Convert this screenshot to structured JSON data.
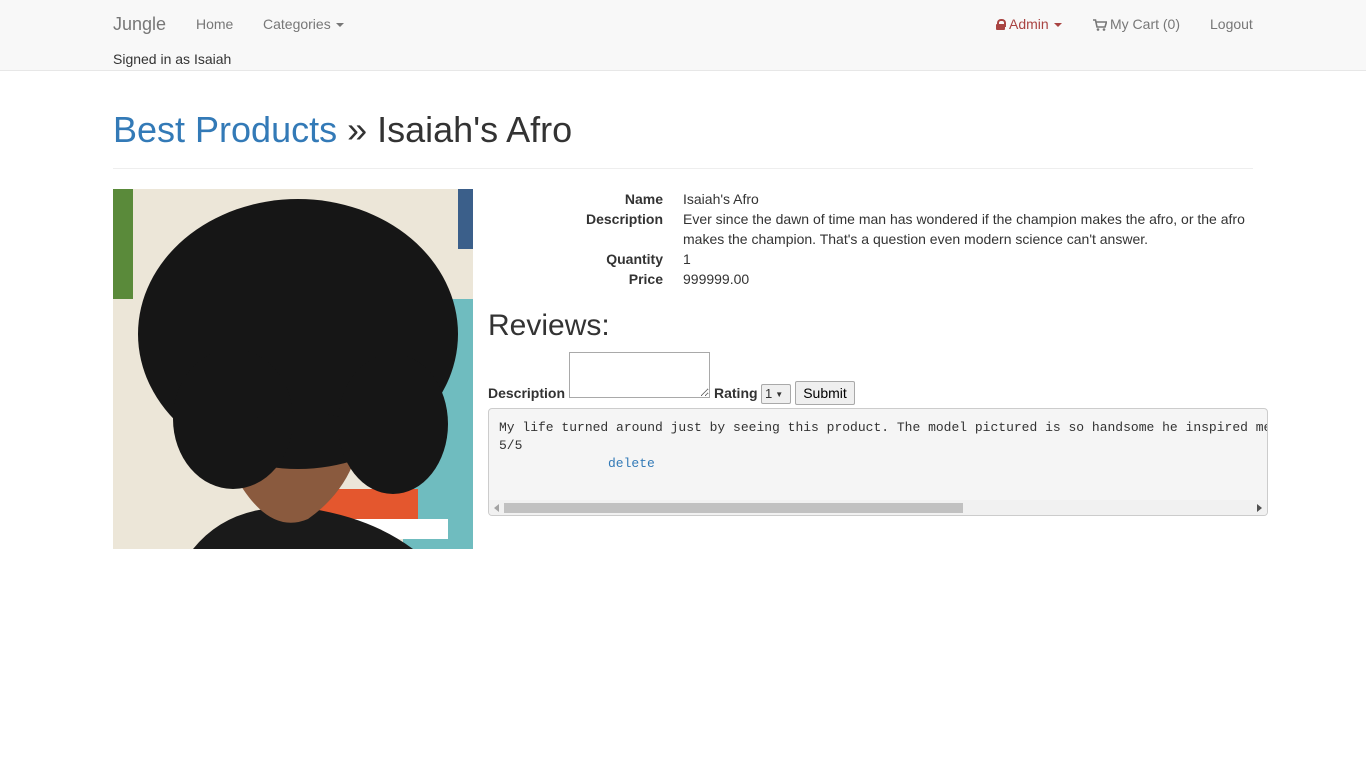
{
  "navbar": {
    "brand": "Jungle",
    "home": "Home",
    "categories": "Categories",
    "admin": "Admin",
    "cart": "My Cart (0)",
    "logout": "Logout",
    "signed_in": "Signed in as Isaiah"
  },
  "header": {
    "breadcrumb_link": "Best Products",
    "separator": " » ",
    "title": "Isaiah's Afro"
  },
  "product": {
    "image_alt": "Isaiah's Afro",
    "details": [
      {
        "label": "Name",
        "value": "Isaiah's Afro"
      },
      {
        "label": "Description",
        "value": "Ever since the dawn of time man has wondered if the champion makes the afro, or the afro makes the champion. That's a question even modern science can't answer."
      },
      {
        "label": "Quantity",
        "value": "1"
      },
      {
        "label": "Price",
        "value": "999999.00"
      }
    ]
  },
  "reviews": {
    "heading": "Reviews:",
    "form": {
      "description_label": "Description",
      "rating_label": "Rating",
      "rating_value": "1",
      "submit_label": "Submit"
    },
    "items": [
      {
        "text": "My life turned around just by seeing this product. The model pictured is so handsome he inspired me",
        "rating": "5/5",
        "delete_label": "delete"
      }
    ]
  },
  "colors": {
    "link": "#337ab7",
    "admin": "#a94442",
    "navbar_bg": "#f8f8f8"
  }
}
